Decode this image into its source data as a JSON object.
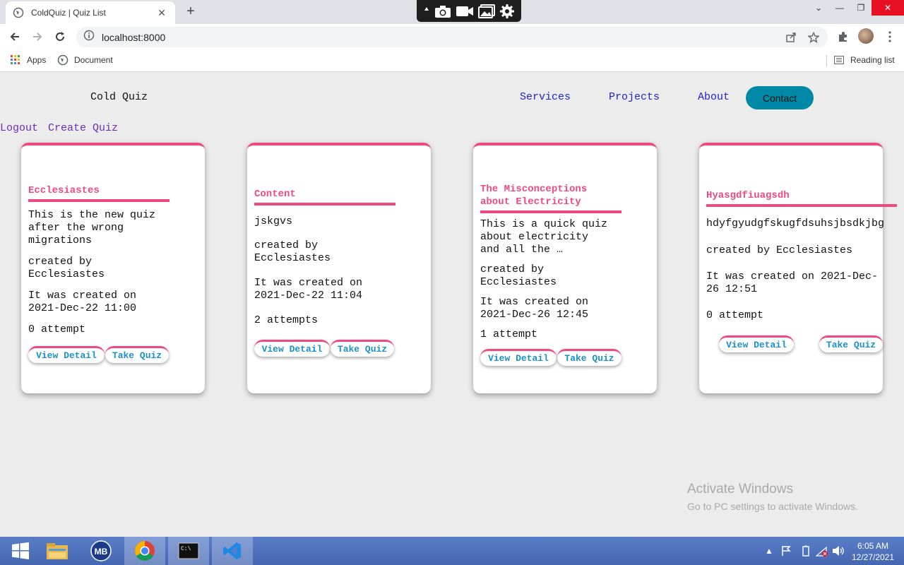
{
  "browser": {
    "tab_title": "ColdQuiz | Quiz List",
    "url": "localhost:8000",
    "bookmarks": [
      "Apps",
      "Document"
    ],
    "reading_list": "Reading list"
  },
  "site": {
    "brand": "Cold Quiz",
    "nav": [
      "Services",
      "Projects",
      "About"
    ],
    "contact_label": "Contact",
    "logout_label": "Logout",
    "create_label": "Create Quiz"
  },
  "quizzes": [
    {
      "title": "Ecclesiastes",
      "description": [
        "This is the new quiz",
        "after the wrong",
        "migrations"
      ],
      "created_by": [
        "created by",
        "Ecclesiastes"
      ],
      "created_on": [
        "It was created on",
        "2021-Dec-22 11:00"
      ],
      "attempts": "0 attempt",
      "view_label": "View Detail",
      "take_label": "Take Quiz"
    },
    {
      "title": "Content",
      "description": [
        "jskgvs"
      ],
      "created_by": [
        "created by",
        "Ecclesiastes"
      ],
      "created_on": [
        "It was created on",
        "2021-Dec-22 11:04"
      ],
      "attempts": "2 attempts",
      "view_label": "View Detail",
      "take_label": "Take Quiz"
    },
    {
      "title_lines": [
        "The Misconceptions",
        "about Electricity"
      ],
      "description": [
        "This is a quick quiz",
        "about electricity",
        "and all the …"
      ],
      "created_by": [
        "created by",
        "Ecclesiastes"
      ],
      "created_on": [
        "It was created on",
        "2021-Dec-26 12:45"
      ],
      "attempts": "1 attempt",
      "view_label": "View Detail",
      "take_label": "Take Quiz"
    },
    {
      "title": "Hyasgdfiuagsdh",
      "description": [
        "hdyfgyudgfskugfdsuhsjbsdkjbg"
      ],
      "created_by": [
        "created by Ecclesiastes"
      ],
      "created_on": [
        "It was created on 2021-Dec-",
        "26 12:51"
      ],
      "attempts": "0 attempt",
      "view_label": "View Detail",
      "take_label": "Take Quiz"
    }
  ],
  "watermark": {
    "line1": "Activate Windows",
    "line2": "Go to PC settings to activate Windows."
  },
  "taskbar": {
    "time": "6:05 AM",
    "date": "12/27/2021"
  },
  "colors": {
    "accent_pink": "#ed4a7f",
    "contact_teal": "#0089a7",
    "nav_blue": "#1d1fd0",
    "button_text_blue": "#1a90c8"
  }
}
